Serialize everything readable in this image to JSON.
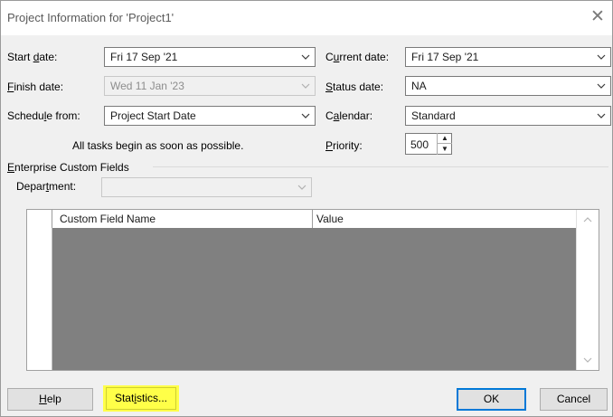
{
  "title": "Project Information for 'Project1'",
  "close_glyph": "✕",
  "start_date": {
    "label_pre": "Start ",
    "label_u": "d",
    "label_post": "ate:",
    "value": "Fri 17 Sep '21"
  },
  "finish_date": {
    "label_pre": "",
    "label_u": "F",
    "label_post": "inish date:",
    "value": "Wed 11 Jan '23"
  },
  "schedule_from": {
    "label_pre": "Schedu",
    "label_u": "l",
    "label_post": "e from:",
    "value": "Project Start Date"
  },
  "note": "All tasks begin as soon as possible.",
  "current_date": {
    "label_pre": "C",
    "label_u": "u",
    "label_post": "rrent date:",
    "value": "Fri 17 Sep '21"
  },
  "status_date": {
    "label_pre": "",
    "label_u": "S",
    "label_post": "tatus date:",
    "value": "NA"
  },
  "calendar": {
    "label_pre": "C",
    "label_u": "a",
    "label_post": "lendar:",
    "value": "Standard"
  },
  "priority": {
    "label_pre": "",
    "label_u": "P",
    "label_post": "riority:",
    "value": "500"
  },
  "enterprise": {
    "label_pre": "",
    "label_u": "E",
    "label_post": "nterprise Custom Fields"
  },
  "department": {
    "label_pre": "Depar",
    "label_u": "t",
    "label_post": "ment:",
    "value": ""
  },
  "grid": {
    "col1": "Custom Field Name",
    "col2": "Value"
  },
  "buttons": {
    "help": {
      "pre": "",
      "u": "H",
      "post": "elp"
    },
    "statistics": {
      "pre": "Stat",
      "u": "i",
      "post": "stics..."
    },
    "ok": "OK",
    "cancel": "Cancel"
  },
  "colors": {
    "highlight": "#ffff48",
    "grid_fill": "#808080",
    "default_button_border": "#0078d7"
  }
}
